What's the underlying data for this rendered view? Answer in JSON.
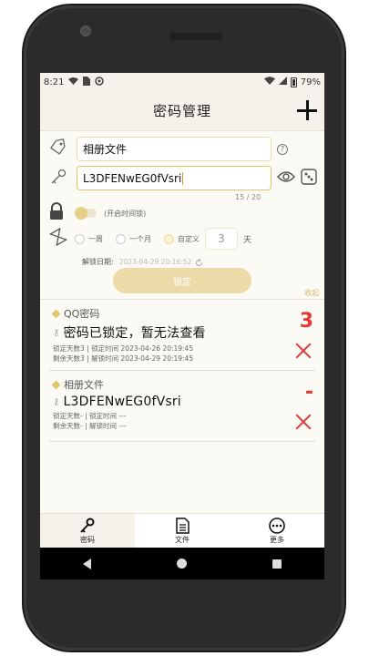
{
  "status_bar": {
    "time": "8:21",
    "battery": "79%"
  },
  "header": {
    "title": "密码管理"
  },
  "form": {
    "name_value": "相册文件",
    "password_value": "L3DFENwEG0fVsri",
    "counter": "15 / 20",
    "timelock_label": "(开启时间锁)",
    "periods": [
      "一周",
      "一个月",
      "自定义"
    ],
    "custom_days": "3",
    "days_unit": "天",
    "unlock_label": "解锁日期:",
    "unlock_date": "2023-04-29 20:16:52",
    "lock_button": "锁定",
    "collapse": "收起"
  },
  "entries": [
    {
      "name": "QQ密码",
      "password": "密码已锁定，暂无法查看",
      "meta1": "锁定天数3 | 锁定时间 2023-04-26 20:19:45",
      "meta2": "剩余天数3 | 解锁时间 2023-04-29 20:19:45",
      "count": "3"
    },
    {
      "name": "相册文件",
      "password": "L3DFENwEG0fVsri",
      "meta1": "锁定天数- | 锁定时间 ---",
      "meta2": "剩余天数- | 解锁时间 ---",
      "count": "-"
    }
  ],
  "bottom_nav": [
    {
      "label": "密码"
    },
    {
      "label": "文件"
    },
    {
      "label": "更多"
    }
  ],
  "colors": {
    "accent": "#e9dcae",
    "danger": "#e53935",
    "button": "#ecdba8"
  }
}
